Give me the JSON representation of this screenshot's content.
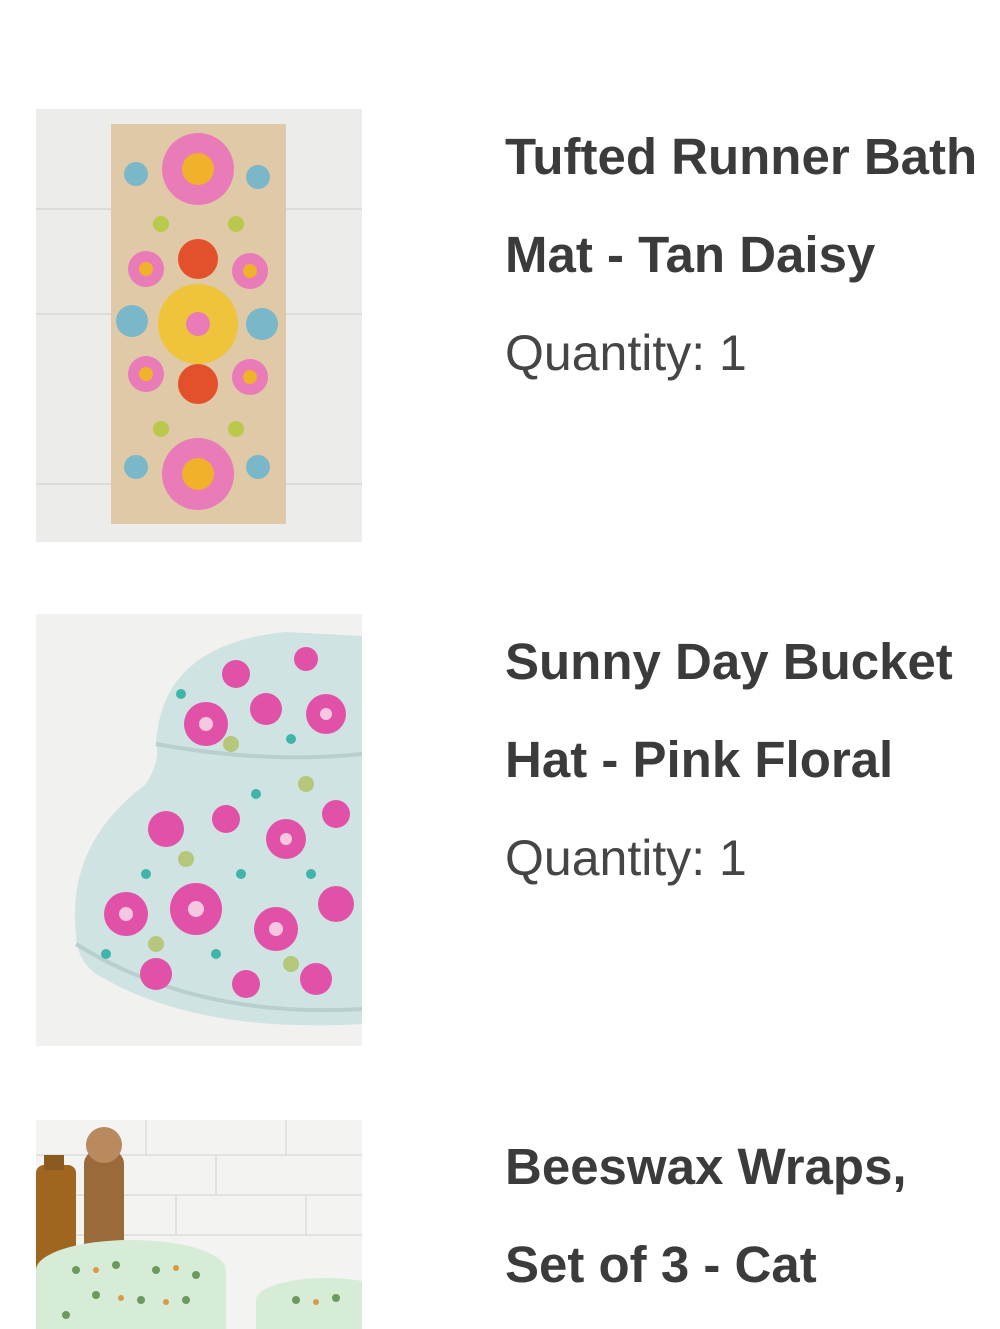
{
  "items": [
    {
      "title": "Tufted Runner Bath Mat - Tan Daisy",
      "quantity_label": "Quantity: 1",
      "image_icon": "bath-mat-product-image"
    },
    {
      "title": "Sunny Day Bucket Hat - Pink Floral",
      "quantity_label": "Quantity: 1",
      "image_icon": "bucket-hat-product-image"
    },
    {
      "title": "Beeswax Wraps, Set of 3 - Cat",
      "image_icon": "beeswax-wraps-product-image"
    }
  ],
  "colors": {
    "text_title": "#3b3b3b",
    "text_quantity": "#454545",
    "background": "#ffffff"
  }
}
